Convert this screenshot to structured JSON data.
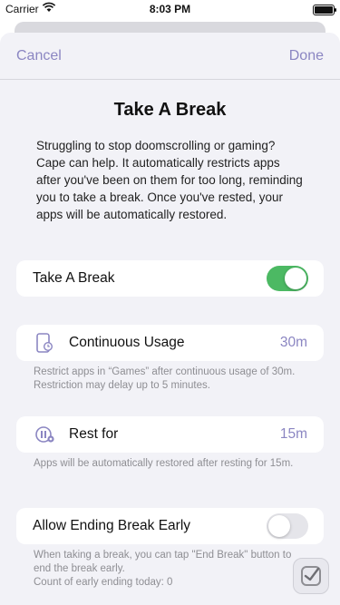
{
  "status_bar": {
    "carrier": "Carrier",
    "time": "8:03 PM"
  },
  "nav": {
    "cancel": "Cancel",
    "done": "Done"
  },
  "title": "Take A Break",
  "description": "Struggling to stop doomscrolling or gaming? Cape can help. It automatically restricts apps after you've been on them for too long, reminding you to take a break. Once you've rested, your apps will be automatically restored.",
  "take_break": {
    "label": "Take A Break",
    "enabled": true
  },
  "continuous_usage": {
    "label": "Continuous Usage",
    "value": "30m",
    "footnote": "Restrict apps in “Games” after continuous usage of 30m. Restriction may delay up to 5 minutes."
  },
  "rest_for": {
    "label": "Rest for",
    "value": "15m",
    "footnote": "Apps will be automatically restored after resting for 15m."
  },
  "early_end": {
    "label": "Allow Ending Break Early",
    "enabled": false,
    "footnote_line1": "When taking a break, you can tap \"End Break\" button to end the break early.",
    "footnote_line2": "Count of early ending today: 0"
  },
  "colors": {
    "accent": "#8b86c2",
    "toggle_on": "#4cb963",
    "background": "#f2f2f7"
  },
  "icons": {
    "phone_timer": "phone-timer-icon",
    "rest": "rest-pause-icon",
    "floating": "checkmark-app-icon"
  }
}
